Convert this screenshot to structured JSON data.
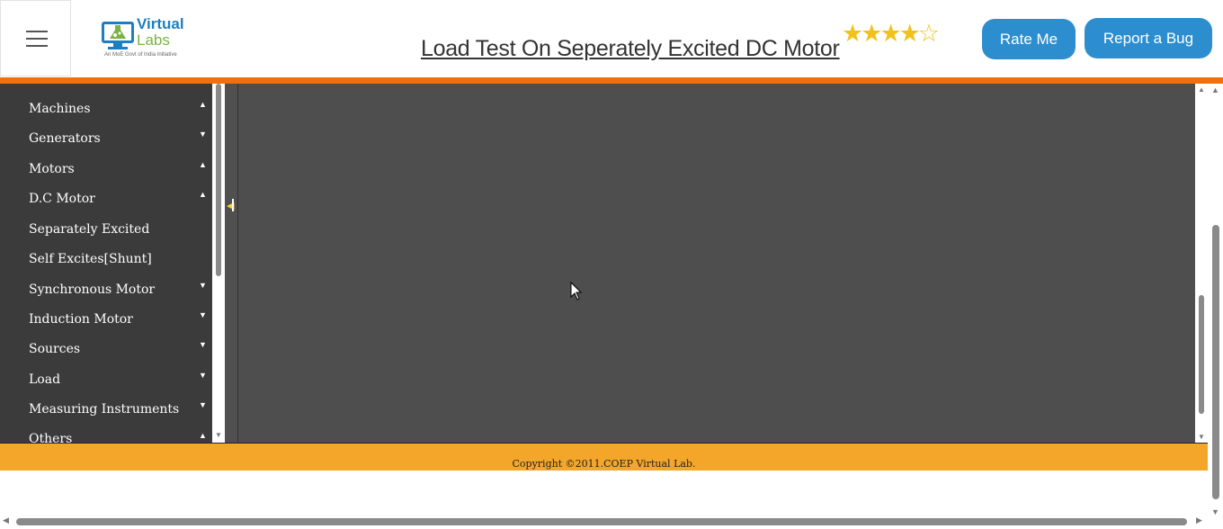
{
  "header": {
    "logo_line1": "Virtual",
    "logo_line2": "Labs",
    "logo_tagline": "An MoE Govt of India Initiative",
    "title": "Load Test On Seperately Excited DC Motor",
    "rating": {
      "filled": 4,
      "total": 5
    },
    "rate_button": "Rate Me",
    "bug_button": "Report a Bug",
    "accent_color": "#2d8ecf",
    "divider_color": "#f07010"
  },
  "sidebar": {
    "items": [
      {
        "label": "Machines",
        "arrow": "▲"
      },
      {
        "label": "Generators",
        "arrow": "▼"
      },
      {
        "label": "Motors",
        "arrow": "▲"
      },
      {
        "label": "D.C Motor",
        "arrow": "▲"
      },
      {
        "label": "Separately Excited",
        "arrow": ""
      },
      {
        "label": "Self Excites[Shunt]",
        "arrow": ""
      },
      {
        "label": "Synchronous Motor",
        "arrow": "▼"
      },
      {
        "label": "Induction Motor",
        "arrow": "▼"
      },
      {
        "label": "Sources",
        "arrow": "▼"
      },
      {
        "label": "Load",
        "arrow": "▼"
      },
      {
        "label": "Measuring Instruments",
        "arrow": "▼"
      },
      {
        "label": "Others",
        "arrow": "▲"
      }
    ]
  },
  "footer": {
    "copyright": "Copyright ©2011.COEP Virtual Lab.",
    "color": "#f4a62a"
  },
  "icons": {
    "menu": "hamburger-icon",
    "star": "star-icon",
    "collapse": "collapse-left-icon",
    "cursor": "mouse-pointer-icon"
  }
}
